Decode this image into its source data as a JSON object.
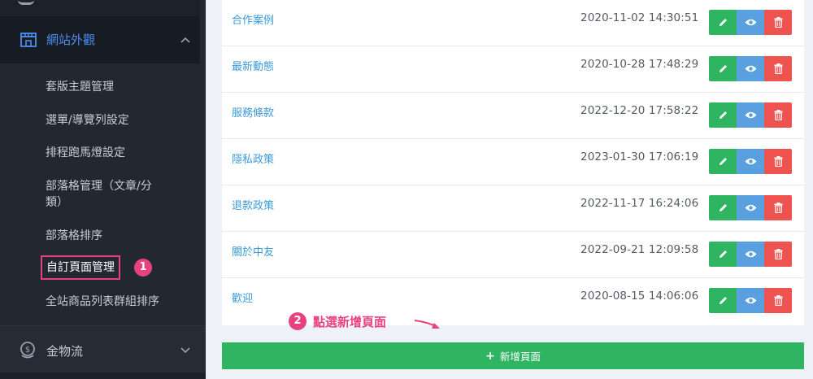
{
  "sidebar": {
    "section_title": "網站外觀",
    "items": [
      {
        "label": "套版主題管理"
      },
      {
        "label": "選單/導覽列設定"
      },
      {
        "label": "排程跑馬燈設定"
      },
      {
        "label": "部落格管理（文章/分"
      },
      {
        "label": "類）"
      },
      {
        "label": "部落格排序"
      },
      {
        "label": "自訂頁面管理"
      },
      {
        "label": "全站商品列表群組排序"
      }
    ],
    "step1_badge": "1",
    "bottom_section_title": "金物流"
  },
  "pages": [
    {
      "title": "合作案例",
      "date": "2020-11-02 14:30:51"
    },
    {
      "title": "最新動態",
      "date": "2020-10-28 17:48:29"
    },
    {
      "title": "服務條款",
      "date": "2022-12-20 17:58:22"
    },
    {
      "title": "隱私政策",
      "date": "2023-01-30 17:06:19"
    },
    {
      "title": "退款政策",
      "date": "2022-11-17 16:24:06"
    },
    {
      "title": "關於中友",
      "date": "2022-09-21 12:09:58"
    },
    {
      "title": "歡迎",
      "date": "2020-08-15 14:06:06"
    }
  ],
  "annotation": {
    "badge": "2",
    "text": "點選新增頁面"
  },
  "add_button": {
    "icon": "plus-icon",
    "label": "新增頁面"
  },
  "colors": {
    "accent_pink": "#e8427e",
    "green": "#2fb461",
    "blue": "#5a9fe0",
    "red": "#ef5350",
    "link": "#3a9ad9"
  }
}
